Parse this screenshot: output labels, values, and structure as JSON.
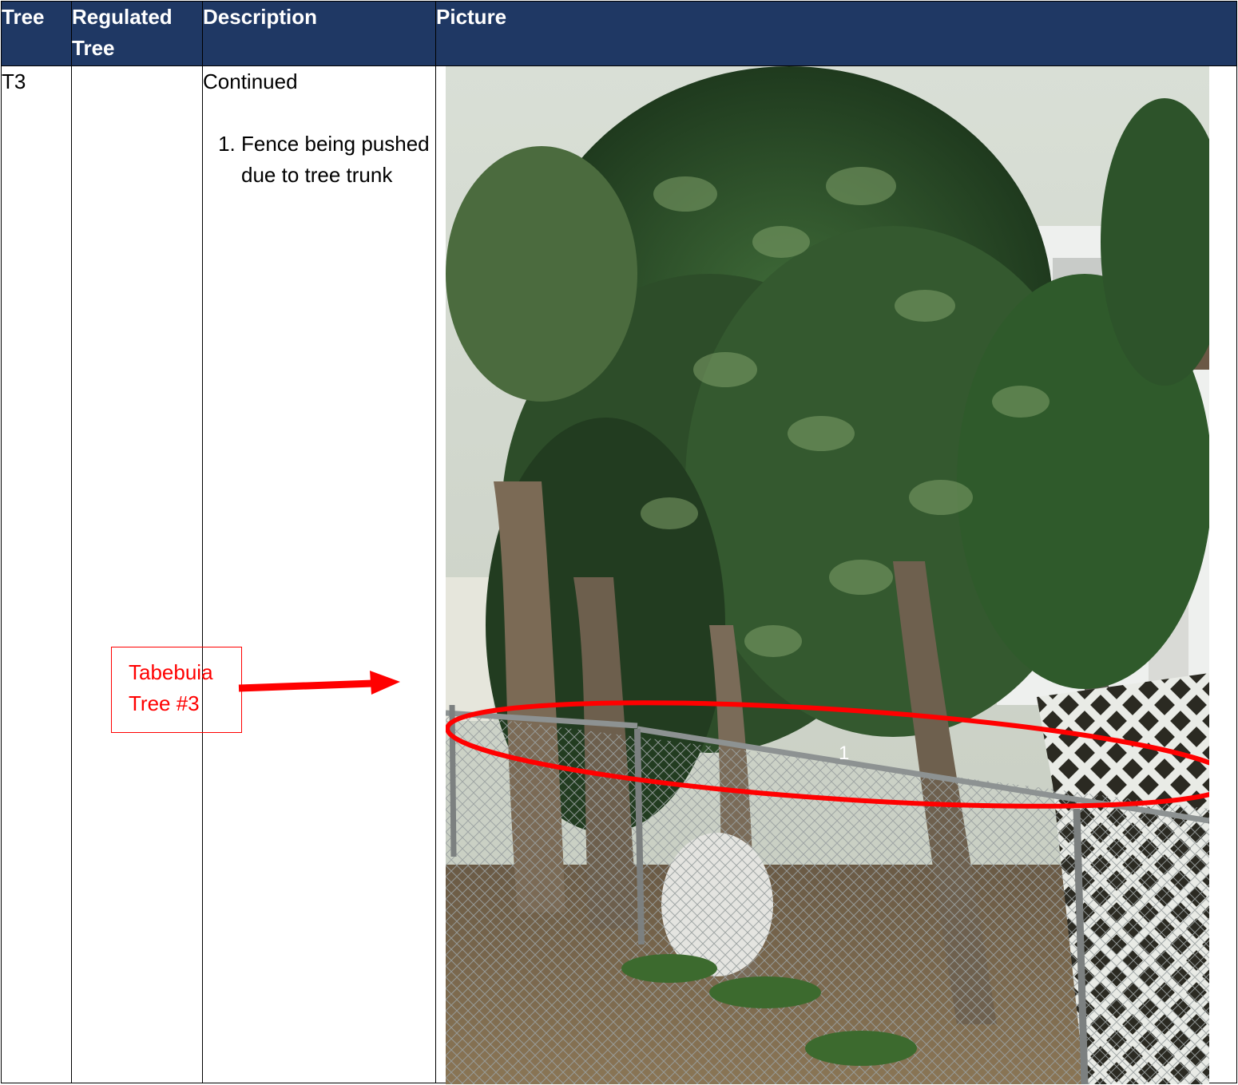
{
  "headers": {
    "tree": "Tree",
    "regulated_tree": "Regulated Tree",
    "description": "Description",
    "picture": "Picture"
  },
  "row": {
    "tree_id": "T3",
    "regulated": "",
    "description_intro": "Continued",
    "description_items": [
      "Fence being pushed due to tree trunk"
    ]
  },
  "annotation": {
    "callout_text": "Tabebuia Tree #3",
    "marker_number": "1",
    "color": "#ff0000"
  },
  "colors": {
    "header_bg": "#1f3864",
    "header_text": "#ffffff",
    "border": "#000000"
  },
  "photo": {
    "subject": "tree-with-chain-link-fence-and-lattice"
  }
}
